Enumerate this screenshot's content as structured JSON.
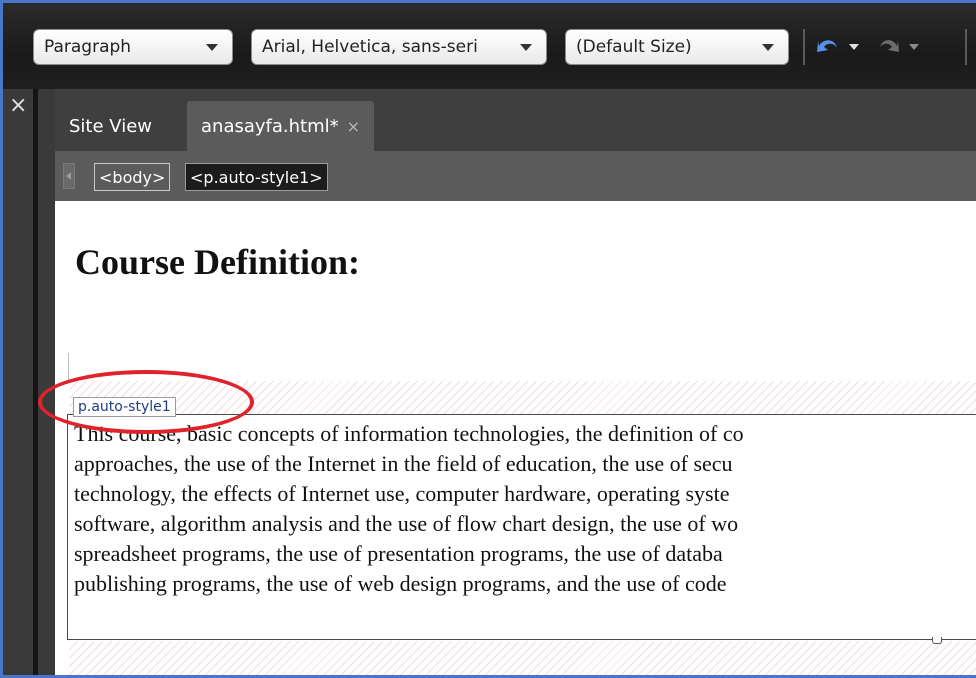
{
  "toolbar": {
    "block_format": "Paragraph",
    "font_family": "Arial, Helvetica, sans-seri",
    "font_size": "(Default Size)",
    "undo_icon": "undo-icon",
    "redo_icon": "redo-icon"
  },
  "panel": {
    "close_glyph": "×"
  },
  "tabs": [
    {
      "label": "Site View"
    },
    {
      "label": "anasayfa.html*",
      "close_glyph": "×"
    }
  ],
  "tag_selector": {
    "items": [
      "<body>",
      "<p.auto-style1>"
    ]
  },
  "document": {
    "heading": "Course Definition:",
    "style_label": "p.auto-style1",
    "paragraph_lines": [
      "This course, basic concepts of information technologies, the definition of co",
      "approaches, the use of the Internet in the field of education, the use of secu",
      "technology, the effects of Internet use, computer hardware, operating syste",
      "software, algorithm analysis and the use of flow chart design, the use of wo",
      "spreadsheet programs, the use of presentation programs, the use of databa",
      "publishing programs, the use of web design programs, and the use of code"
    ]
  },
  "colors": {
    "frame": "#4a76c9",
    "annotation": "#e0232a",
    "toolbar_bg": "#1f1f1f"
  }
}
